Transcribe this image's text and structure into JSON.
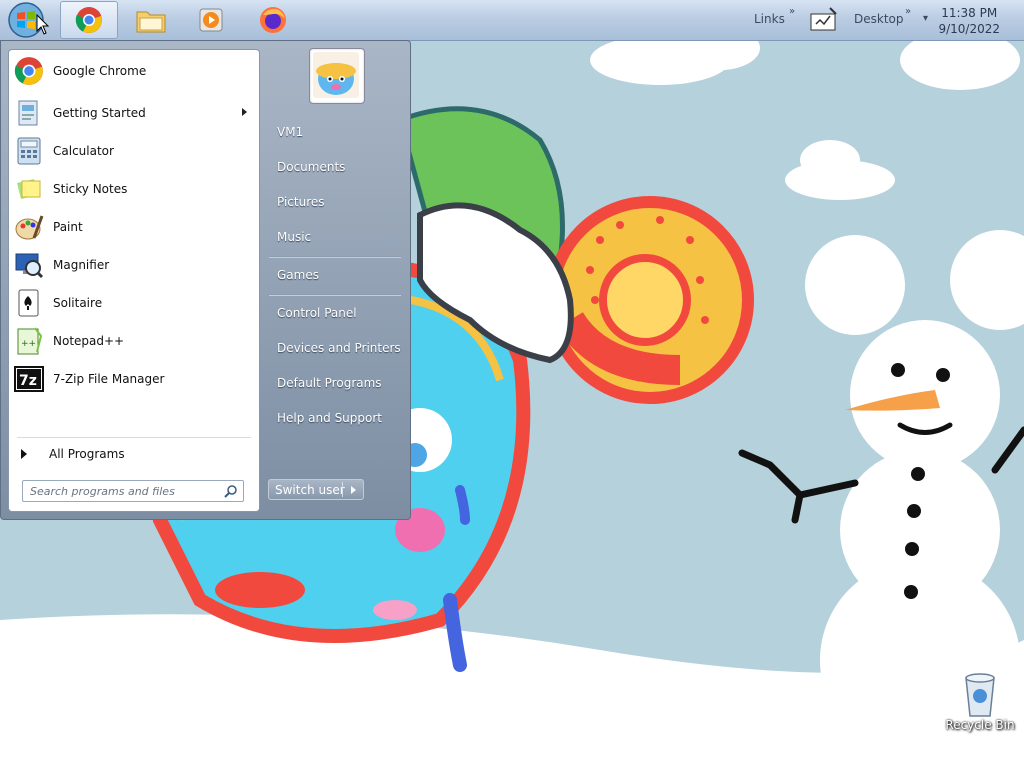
{
  "taskbar": {
    "start_orb_icon": "windows-start-orb-icon",
    "pinned": [
      {
        "name": "chrome",
        "icon": "chrome-icon"
      },
      {
        "name": "explorer",
        "icon": "folder-icon"
      },
      {
        "name": "media-player",
        "icon": "media-player-icon"
      },
      {
        "name": "firefox",
        "icon": "firefox-icon"
      }
    ],
    "links_label": "Links",
    "desktop_label": "Desktop",
    "clock_time": "11:38 PM",
    "clock_date": "9/10/2022"
  },
  "start_menu": {
    "programs": [
      {
        "label": "Google Chrome",
        "icon": "chrome-icon"
      },
      {
        "label": "Getting Started",
        "icon": "getting-started-icon"
      },
      {
        "label": "Calculator",
        "icon": "calculator-icon"
      },
      {
        "label": "Sticky Notes",
        "icon": "sticky-notes-icon"
      },
      {
        "label": "Paint",
        "icon": "paint-icon"
      },
      {
        "label": "Magnifier",
        "icon": "magnifier-icon"
      },
      {
        "label": "Solitaire",
        "icon": "solitaire-icon"
      },
      {
        "label": "Notepad++",
        "icon": "notepad-plus-plus-icon"
      },
      {
        "label": "7-Zip File Manager",
        "icon": "seven-zip-icon"
      }
    ],
    "all_programs_label": "All Programs",
    "search_placeholder": "Search programs and files",
    "right_items": [
      {
        "label": "VM1"
      },
      {
        "label": "Documents"
      },
      {
        "label": "Pictures"
      },
      {
        "label": "Music"
      },
      {
        "label": "Games"
      },
      {
        "label": "Control Panel"
      },
      {
        "label": "Devices and Printers"
      },
      {
        "label": "Default Programs"
      },
      {
        "label": "Help and Support"
      }
    ],
    "switch_user_label": "Switch user"
  },
  "desktop": {
    "recycle_bin_label": "Recycle Bin"
  }
}
